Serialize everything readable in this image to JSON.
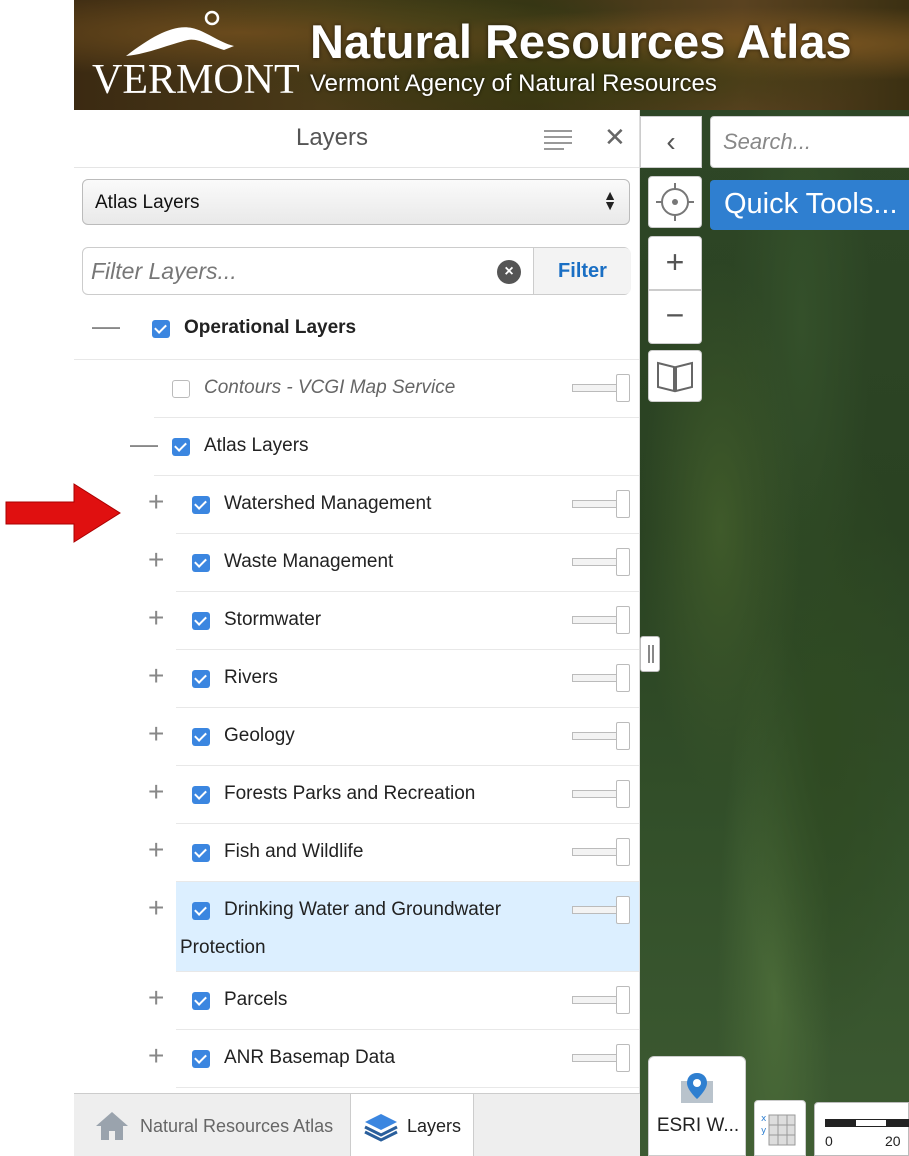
{
  "header": {
    "state": "VERMONT",
    "title": "Natural Resources Atlas",
    "subtitle": "Vermont Agency of Natural Resources"
  },
  "panel": {
    "title": "Layers",
    "select_value": "Atlas Layers",
    "filter_placeholder": "Filter Layers...",
    "filter_button": "Filter",
    "rows": [
      {
        "label": "Operational Layers",
        "checked": true,
        "toggle": "—"
      },
      {
        "label": "Contours - VCGI Map Service",
        "checked": false,
        "toggle": ""
      },
      {
        "label": "Atlas Layers",
        "checked": true,
        "toggle": "—"
      },
      {
        "label": "Watershed Management",
        "checked": true,
        "toggle": "+"
      },
      {
        "label": "Waste Management",
        "checked": true,
        "toggle": "+"
      },
      {
        "label": "Stormwater",
        "checked": true,
        "toggle": "+"
      },
      {
        "label": "Rivers",
        "checked": true,
        "toggle": "+"
      },
      {
        "label": "Geology",
        "checked": true,
        "toggle": "+"
      },
      {
        "label": "Forests Parks and Recreation",
        "checked": true,
        "toggle": "+"
      },
      {
        "label": "Fish and Wildlife",
        "checked": true,
        "toggle": "+"
      },
      {
        "label": "Drinking Water and Groundwater",
        "label2": "Protection",
        "checked": true,
        "toggle": "+"
      },
      {
        "label": "Parcels",
        "checked": true,
        "toggle": "+"
      },
      {
        "label": "ANR Basemap Data",
        "checked": true,
        "toggle": "+"
      }
    ]
  },
  "tabs": {
    "atlas": "Natural Resources Atlas",
    "layers": "Layers"
  },
  "map": {
    "search_placeholder": "Search...",
    "quick_tools": "Quick Tools...",
    "basemap_label": "ESRI W...",
    "scale_zero": "0",
    "scale_value": "20"
  },
  "colors": {
    "accent": "#2f7fd0",
    "checkbox": "#3b86e0",
    "highlight_row": "#dcefff",
    "arrow": "#e01010"
  }
}
